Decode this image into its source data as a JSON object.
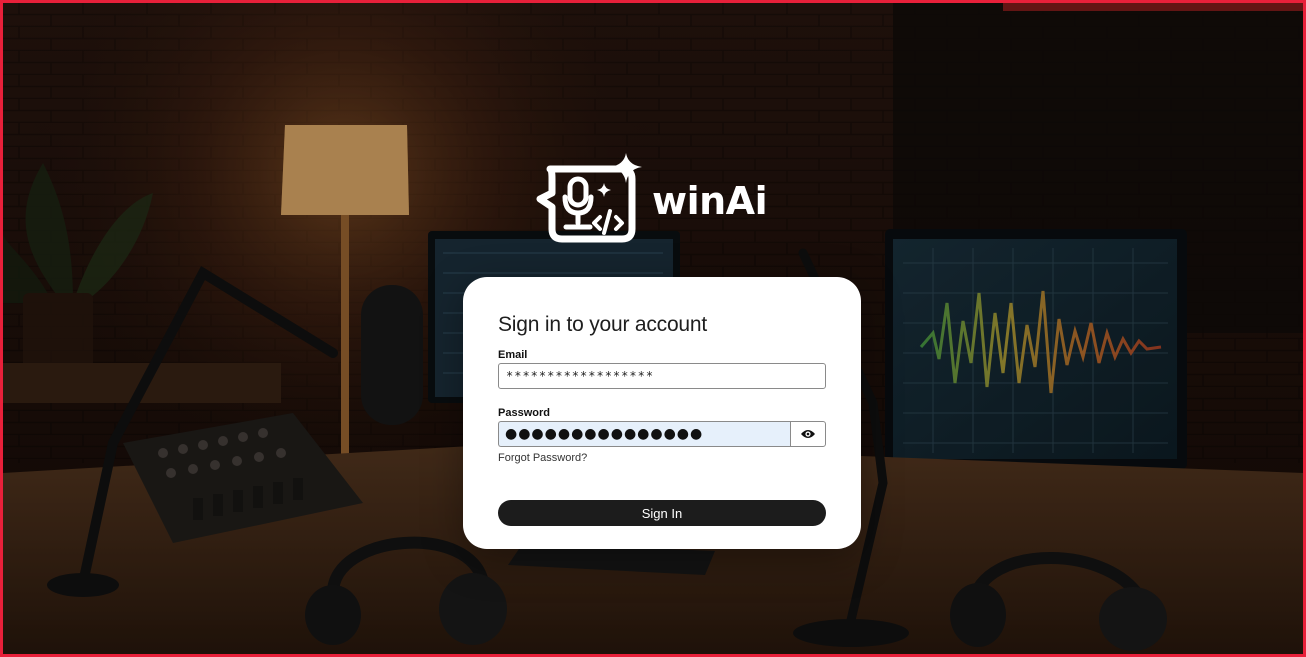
{
  "brand": {
    "name": "winAi",
    "logo_icon": "microphone-code-sparkle-icon"
  },
  "background": {
    "scene": "podcast studio"
  },
  "form": {
    "title": "Sign in to your account",
    "email_label": "Email",
    "email_value": "******************",
    "password_label": "Password",
    "password_value": "●●●●●●●●●●●●●●●",
    "show_password_icon": "eye-icon",
    "forgot_link": "Forgot Password?",
    "submit_label": "Sign In"
  },
  "colors": {
    "frame_border": "#e8203a",
    "button_bg": "#1c1c1c",
    "password_bg": "#e6f0fb"
  }
}
